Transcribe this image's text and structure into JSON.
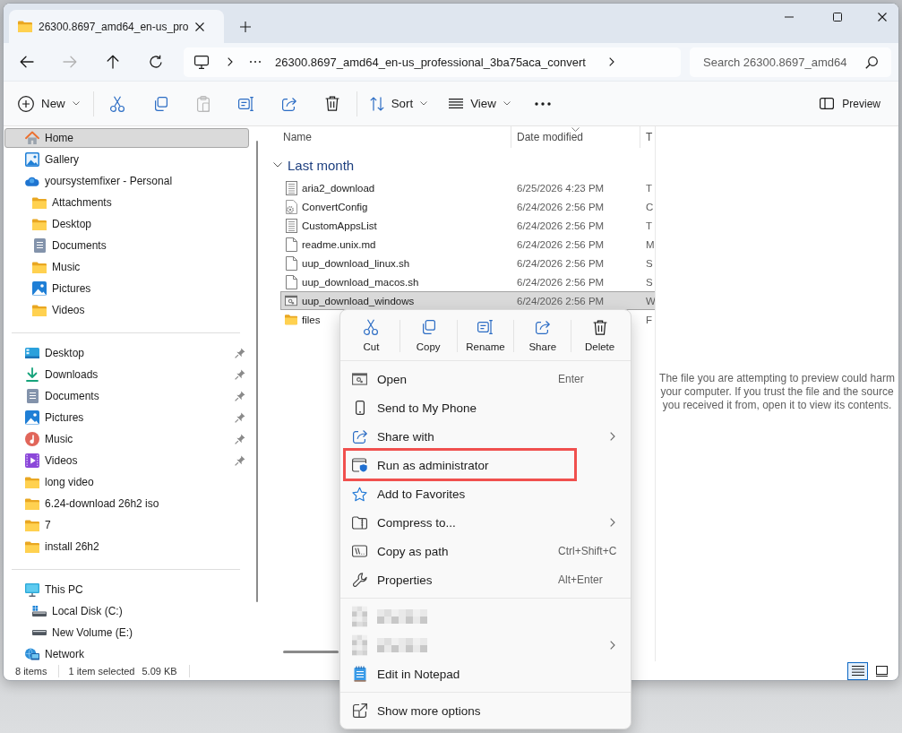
{
  "tabs": [
    {
      "label": "26300.8697_amd64_en-us_pro",
      "selected": true
    }
  ],
  "navigation": [
    {
      "kind": "back",
      "disabled": false
    },
    {
      "kind": "forward",
      "disabled": true
    },
    {
      "kind": "up",
      "disabled": false
    },
    {
      "kind": "refresh",
      "disabled": false
    }
  ],
  "address_bar": {
    "path": "26300.8697_amd64_en-us_professional_3ba75aca_convert"
  },
  "search": {
    "placeholder": "Search 26300.8697_amd64"
  },
  "command_bar": {
    "groups": [
      [
        {
          "kind": "new",
          "label": "New",
          "disabled": false,
          "dropdown": true
        }
      ],
      [
        {
          "kind": "cut",
          "disabled": false,
          "dropdown": false
        },
        {
          "kind": "copy",
          "disabled": false,
          "dropdown": false
        },
        {
          "kind": "paste",
          "disabled": true,
          "dropdown": false
        },
        {
          "kind": "rename",
          "disabled": false,
          "dropdown": false
        },
        {
          "kind": "share",
          "disabled": false,
          "dropdown": false
        },
        {
          "kind": "delete",
          "disabled": false,
          "dropdown": false
        }
      ],
      [
        {
          "kind": "sort",
          "label": "Sort",
          "disabled": false,
          "dropdown": true
        },
        {
          "kind": "view",
          "label": "View",
          "disabled": false,
          "dropdown": true
        },
        {
          "kind": "more",
          "disabled": false,
          "dropdown": false
        }
      ]
    ],
    "preview": {
      "label": "Preview"
    }
  },
  "sidebar": {
    "sections": [
      {
        "items": [
          {
            "label": "Home",
            "kind": "home",
            "selected": true
          },
          {
            "label": "Gallery",
            "kind": "gallery",
            "selected": false
          },
          {
            "label": "yoursystemfixer - Personal",
            "kind": "cloud",
            "selected": false,
            "children": [
              {
                "label": "Attachments",
                "kind": "folder",
                "selected": false
              },
              {
                "label": "Desktop",
                "kind": "folder",
                "selected": false
              },
              {
                "label": "Documents",
                "kind": "documents",
                "selected": false
              },
              {
                "label": "Music",
                "kind": "folder",
                "selected": false
              },
              {
                "label": "Pictures",
                "kind": "pictures",
                "selected": false
              },
              {
                "label": "Videos",
                "kind": "folder",
                "selected": false
              }
            ]
          }
        ]
      },
      {
        "items": [
          {
            "label": "Desktop",
            "kind": "desktop",
            "selected": false,
            "pinned": true
          },
          {
            "label": "Downloads",
            "kind": "downloads",
            "selected": false,
            "pinned": true
          },
          {
            "label": "Documents",
            "kind": "documents",
            "selected": false,
            "pinned": true
          },
          {
            "label": "Pictures",
            "kind": "pictures",
            "selected": false,
            "pinned": true
          },
          {
            "label": "Music",
            "kind": "music",
            "selected": false,
            "pinned": true
          },
          {
            "label": "Videos",
            "kind": "videos",
            "selected": false,
            "pinned": true
          },
          {
            "label": "long video",
            "kind": "folder",
            "selected": false,
            "pinned": false
          },
          {
            "label": "6.24-download 26h2 iso",
            "kind": "folder",
            "selected": false,
            "pinned": false
          },
          {
            "label": "7",
            "kind": "folder",
            "selected": false,
            "pinned": false
          },
          {
            "label": "install 26h2",
            "kind": "folder",
            "selected": false,
            "pinned": false
          }
        ]
      },
      {
        "items": [
          {
            "label": "This PC",
            "kind": "pc",
            "selected": false,
            "children": [
              {
                "label": "Local Disk (C:)",
                "kind": "system-drive",
                "selected": false
              },
              {
                "label": "New Volume (E:)",
                "kind": "drive",
                "selected": false
              }
            ]
          },
          {
            "label": "Network",
            "kind": "network",
            "selected": false
          }
        ]
      }
    ]
  },
  "file_list": {
    "columns": [
      {
        "label": "Name",
        "sorted": false
      },
      {
        "label": "Date modified",
        "sorted": true
      },
      {
        "label": "T",
        "sorted": false
      }
    ],
    "groups": [
      {
        "label": "Last month",
        "expanded": true,
        "rows": [
          {
            "name": "aria2_download",
            "kind": "text",
            "date": "6/25/2026 4:23 PM",
            "type": "T",
            "selected": false
          },
          {
            "name": "ConvertConfig",
            "kind": "config",
            "date": "6/24/2026 2:56 PM",
            "type": "C",
            "selected": false
          },
          {
            "name": "CustomAppsList",
            "kind": "text",
            "date": "6/24/2026 2:56 PM",
            "type": "T",
            "selected": false
          },
          {
            "name": "readme.unix.md",
            "kind": "file",
            "date": "6/24/2026 2:56 PM",
            "type": "M",
            "selected": false
          },
          {
            "name": "uup_download_linux.sh",
            "kind": "file",
            "date": "6/24/2026 2:56 PM",
            "type": "S",
            "selected": false
          },
          {
            "name": "uup_download_macos.sh",
            "kind": "file",
            "date": "6/24/2026 2:56 PM",
            "type": "S",
            "selected": false
          },
          {
            "name": "uup_download_windows",
            "kind": "batch",
            "date": "6/24/2026 2:56 PM",
            "type": "W",
            "selected": true
          },
          {
            "name": "files",
            "kind": "folder",
            "type": "F",
            "selected": false
          }
        ]
      }
    ]
  },
  "preview_pane": {
    "message": "The file you are attempting to preview could harm your computer. If you trust the file and the source you received it from, open it to view its contents."
  },
  "status_bar": {
    "item_count": "8 items",
    "selection": "1 item selected",
    "size": "5.09 KB",
    "views": [
      {
        "kind": "details",
        "selected": true
      },
      {
        "kind": "tiles",
        "selected": false
      }
    ]
  },
  "context_menu": {
    "actions": [
      {
        "kind": "cut",
        "label": "Cut"
      },
      {
        "kind": "copy",
        "label": "Copy"
      },
      {
        "kind": "rename",
        "label": "Rename"
      },
      {
        "kind": "share",
        "label": "Share"
      },
      {
        "kind": "delete",
        "label": "Delete"
      }
    ],
    "sections": [
      [
        {
          "kind": "open",
          "label": "Open",
          "shortcut": "Enter",
          "submenu": false,
          "annotated": false
        },
        {
          "kind": "phone",
          "label": "Send to My Phone",
          "submenu": false,
          "annotated": false
        },
        {
          "kind": "share",
          "label": "Share with",
          "submenu": true,
          "annotated": false
        },
        {
          "kind": "admin",
          "label": "Run as administrator",
          "submenu": false,
          "annotated": true
        },
        {
          "kind": "favorite",
          "label": "Add to Favorites",
          "submenu": false,
          "annotated": false
        },
        {
          "kind": "compress",
          "label": "Compress to...",
          "submenu": true,
          "annotated": false
        },
        {
          "kind": "copy-path",
          "label": "Copy as path",
          "shortcut": "Ctrl+Shift+C",
          "submenu": false,
          "annotated": false
        },
        {
          "kind": "properties",
          "label": "Properties",
          "shortcut": "Alt+Enter",
          "submenu": false,
          "annotated": false
        }
      ],
      [
        {
          "kind": "obscured",
          "submenu": false,
          "annotated": false
        },
        {
          "kind": "obscured",
          "submenu": true,
          "annotated": false
        },
        {
          "kind": "notepad",
          "label": "Edit in Notepad",
          "submenu": false,
          "annotated": false
        }
      ],
      [
        {
          "kind": "more-options",
          "label": "Show more options",
          "submenu": false,
          "annotated": false
        }
      ]
    ]
  }
}
